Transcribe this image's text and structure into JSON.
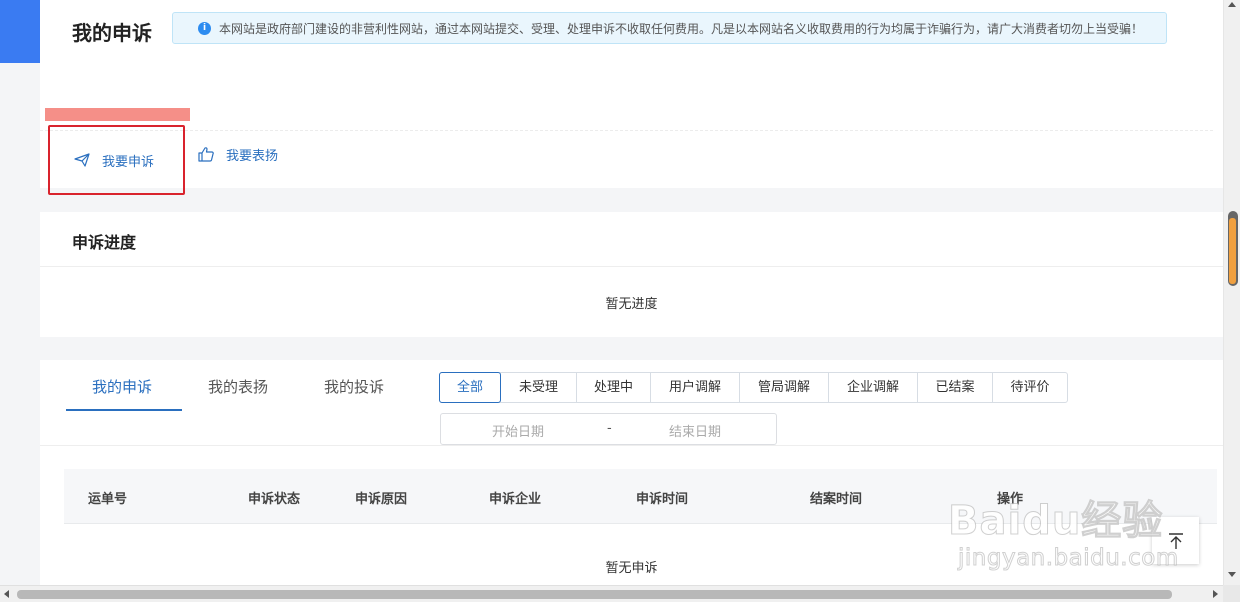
{
  "header": {
    "title": "我的申诉",
    "notice": "本网站是政府部门建设的非营利性网站，通过本网站提交、受理、处理申诉不收取任何费用。凡是以本网站名义收取费用的行为均属于诈骗行为，请广大消费者切勿上当受骗！",
    "notice_icon": "info-icon",
    "actions": {
      "complain_label": "我要申诉",
      "complain_icon": "paper-plane-icon",
      "praise_label": "我要表扬",
      "praise_icon": "thumbs-up-icon"
    }
  },
  "progress": {
    "title": "申诉进度",
    "empty_text": "暂无进度"
  },
  "records": {
    "tabs": [
      "我的申诉",
      "我的表扬",
      "我的投诉"
    ],
    "active_tab": "我的申诉",
    "filters": [
      "全部",
      "未受理",
      "处理中",
      "用户调解",
      "管局调解",
      "企业调解",
      "已结案",
      "待评价"
    ],
    "active_filter": "全部",
    "date_range": {
      "start_placeholder": "开始日期",
      "separator": "-",
      "end_placeholder": "结束日期"
    },
    "columns": [
      "运单号",
      "申诉状态",
      "申诉原因",
      "申诉企业",
      "申诉时间",
      "结案时间",
      "操作"
    ],
    "empty_text": "暂无申诉"
  },
  "watermark": {
    "logo": "Baidu经验",
    "url": "jingyan.baidu.com"
  },
  "colors": {
    "accent": "#2a6fbf",
    "highlight_border": "#d9232d",
    "left_tab": "#3a7bf2",
    "redaction": "#f58f88",
    "notice_bg": "#eaf6fd"
  }
}
